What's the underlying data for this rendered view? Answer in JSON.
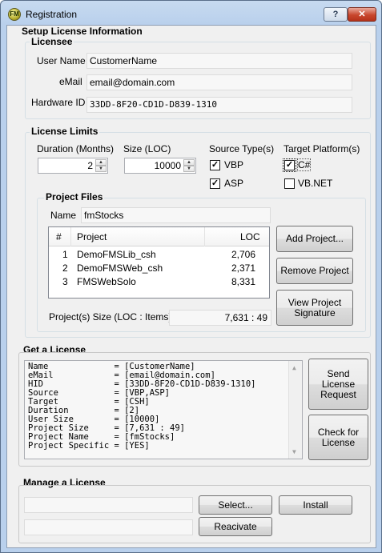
{
  "window": {
    "title": "Registration",
    "help_label": "?",
    "close_label": "✕",
    "icon_label": "FM"
  },
  "setup_title": "Setup License Information",
  "licensee": {
    "legend": "Licensee",
    "user_name_label": "User Name",
    "user_name": "CustomerName",
    "email_label": "eMail",
    "email": "email@domain.com",
    "hardware_id_label": "Hardware ID",
    "hardware_id": "33DD-8F20-CD1D-D839-1310"
  },
  "limits": {
    "legend": "License Limits",
    "duration_label": "Duration (Months)",
    "duration": "2",
    "size_label": "Size (LOC)",
    "size": "10000",
    "source_label": "Source Type(s)",
    "vbp_label": "VBP",
    "vbp_checked": true,
    "asp_label": "ASP",
    "asp_checked": true,
    "target_label": "Target Platform(s)",
    "csharp_label": "C#",
    "csharp_checked": true,
    "vbnet_label": "VB.NET",
    "vbnet_checked": false
  },
  "project_files": {
    "legend": "Project Files",
    "name_label": "Name",
    "name": "fmStocks",
    "columns": [
      "#",
      "Project",
      "LOC"
    ],
    "rows": [
      {
        "num": "1",
        "project": "DemoFMSLib_csh",
        "loc": "2,706"
      },
      {
        "num": "2",
        "project": "DemoFMSWeb_csh",
        "loc": "2,371"
      },
      {
        "num": "3",
        "project": "FMSWebSolo",
        "loc": "8,331"
      }
    ],
    "add_label": "Add Project...",
    "remove_label": "Remove Project",
    "view_label": "View Project Signature",
    "size_label": "Project(s) Size (LOC : Items)",
    "size_value": "7,631 : 49"
  },
  "get_license": {
    "title": "Get a License",
    "request_lines": [
      "Name             = [CustomerName]",
      "eMail            = [email@domain.com]",
      "HID              = [33DD-8F20-CD1D-D839-1310]",
      "Source           = [VBP,ASP]",
      "Target           = [CSH]",
      "Duration         = [2]",
      "User Size        = [10000]",
      "Project Size     = [7,631 : 49]",
      "Project Name     = [fmStocks]",
      "Project Specific = [YES]"
    ],
    "send_label": "Send License Request",
    "check_label": "Check for License"
  },
  "manage": {
    "title": "Manage a License",
    "file_path": "",
    "select_label": "Select...",
    "install_label": "Install",
    "reactivate_path": "",
    "reactivate_label": "Reacivate"
  }
}
